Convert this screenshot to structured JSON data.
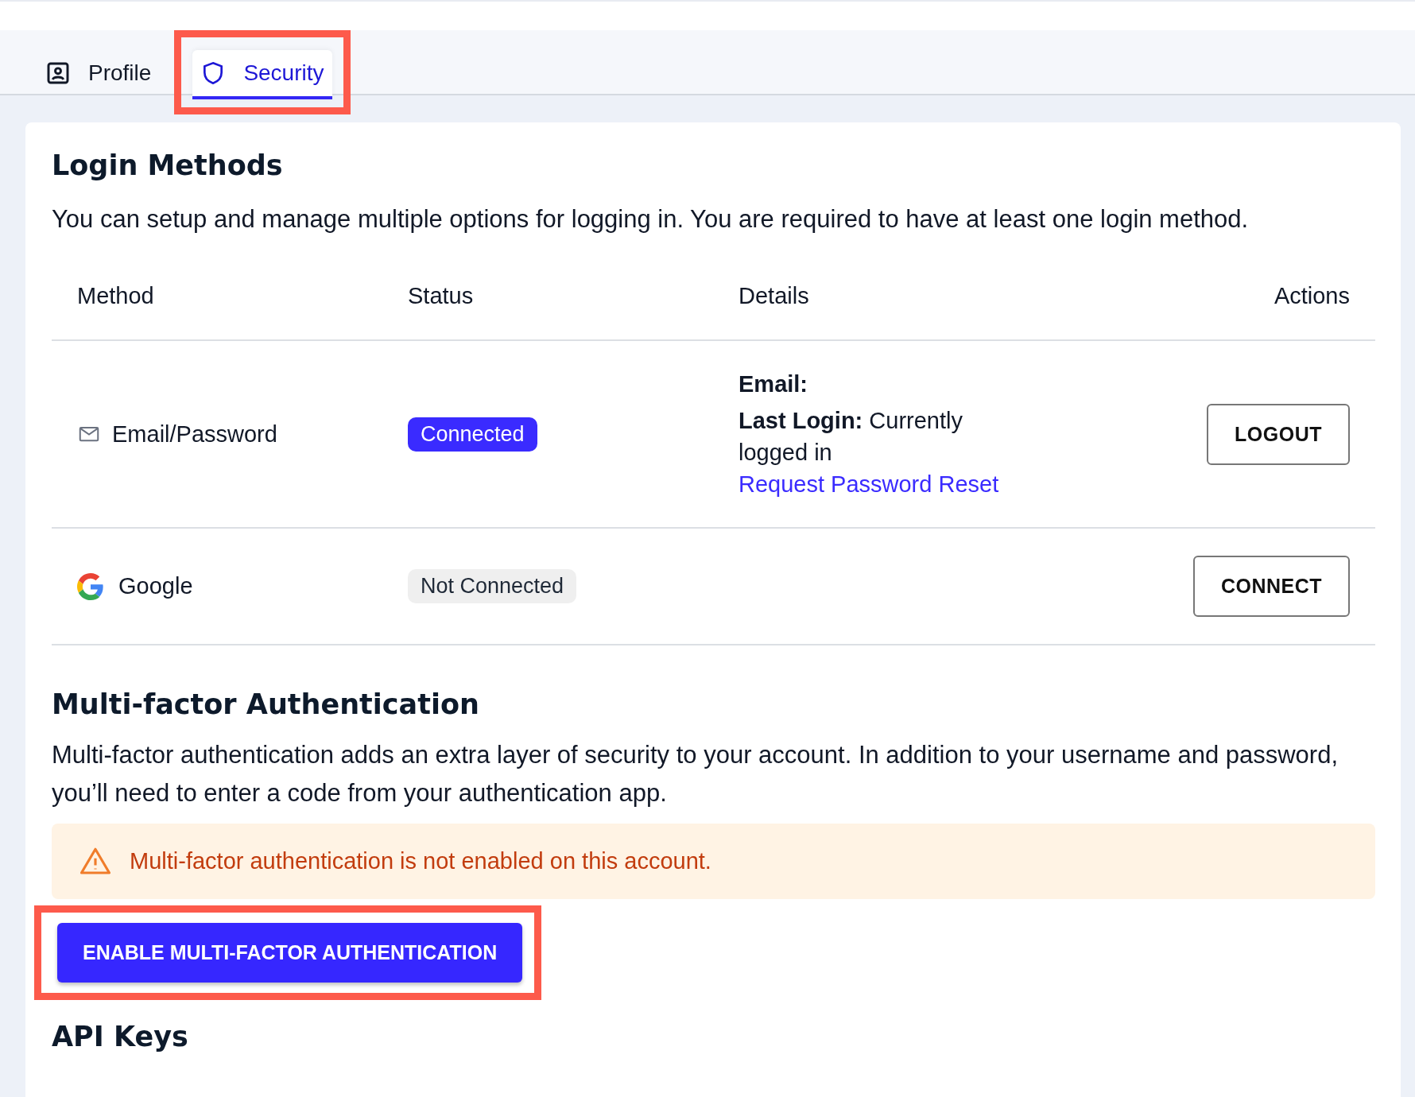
{
  "tabs": [
    {
      "label": "Profile",
      "kind": "profile",
      "selected": false,
      "highlighted": false
    },
    {
      "label": "Security",
      "kind": "security",
      "selected": true,
      "highlighted": true
    }
  ],
  "login_methods": {
    "title": "Login Methods",
    "description": "You can setup and manage multiple options for logging in. You are required to have at least one login method.",
    "columns": [
      "Method",
      "Status",
      "Details",
      "Actions"
    ],
    "rows": [
      {
        "kind": "email",
        "method": "Email/Password",
        "status": "Connected",
        "connected": true,
        "details": [
          {
            "label": "Email:"
          },
          {
            "label": "Last Login:",
            "value": "Currently logged in"
          }
        ],
        "link": "Request Password Reset",
        "action": "LOGOUT"
      },
      {
        "kind": "google",
        "method": "Google",
        "status": "Not Connected",
        "connected": false,
        "action": "CONNECT"
      }
    ]
  },
  "mfa": {
    "title": "Multi-factor Authentication",
    "description": "Multi-factor authentication adds an extra layer of security to your account. In addition to your username and password, you’ll need to enter a code from your authentication app.",
    "alert": "Multi-factor authentication is not enabled on this account.",
    "button": "ENABLE MULTI-FACTOR AUTHENTICATION",
    "button_highlighted": true
  },
  "api_keys": {
    "title": "API Keys"
  }
}
